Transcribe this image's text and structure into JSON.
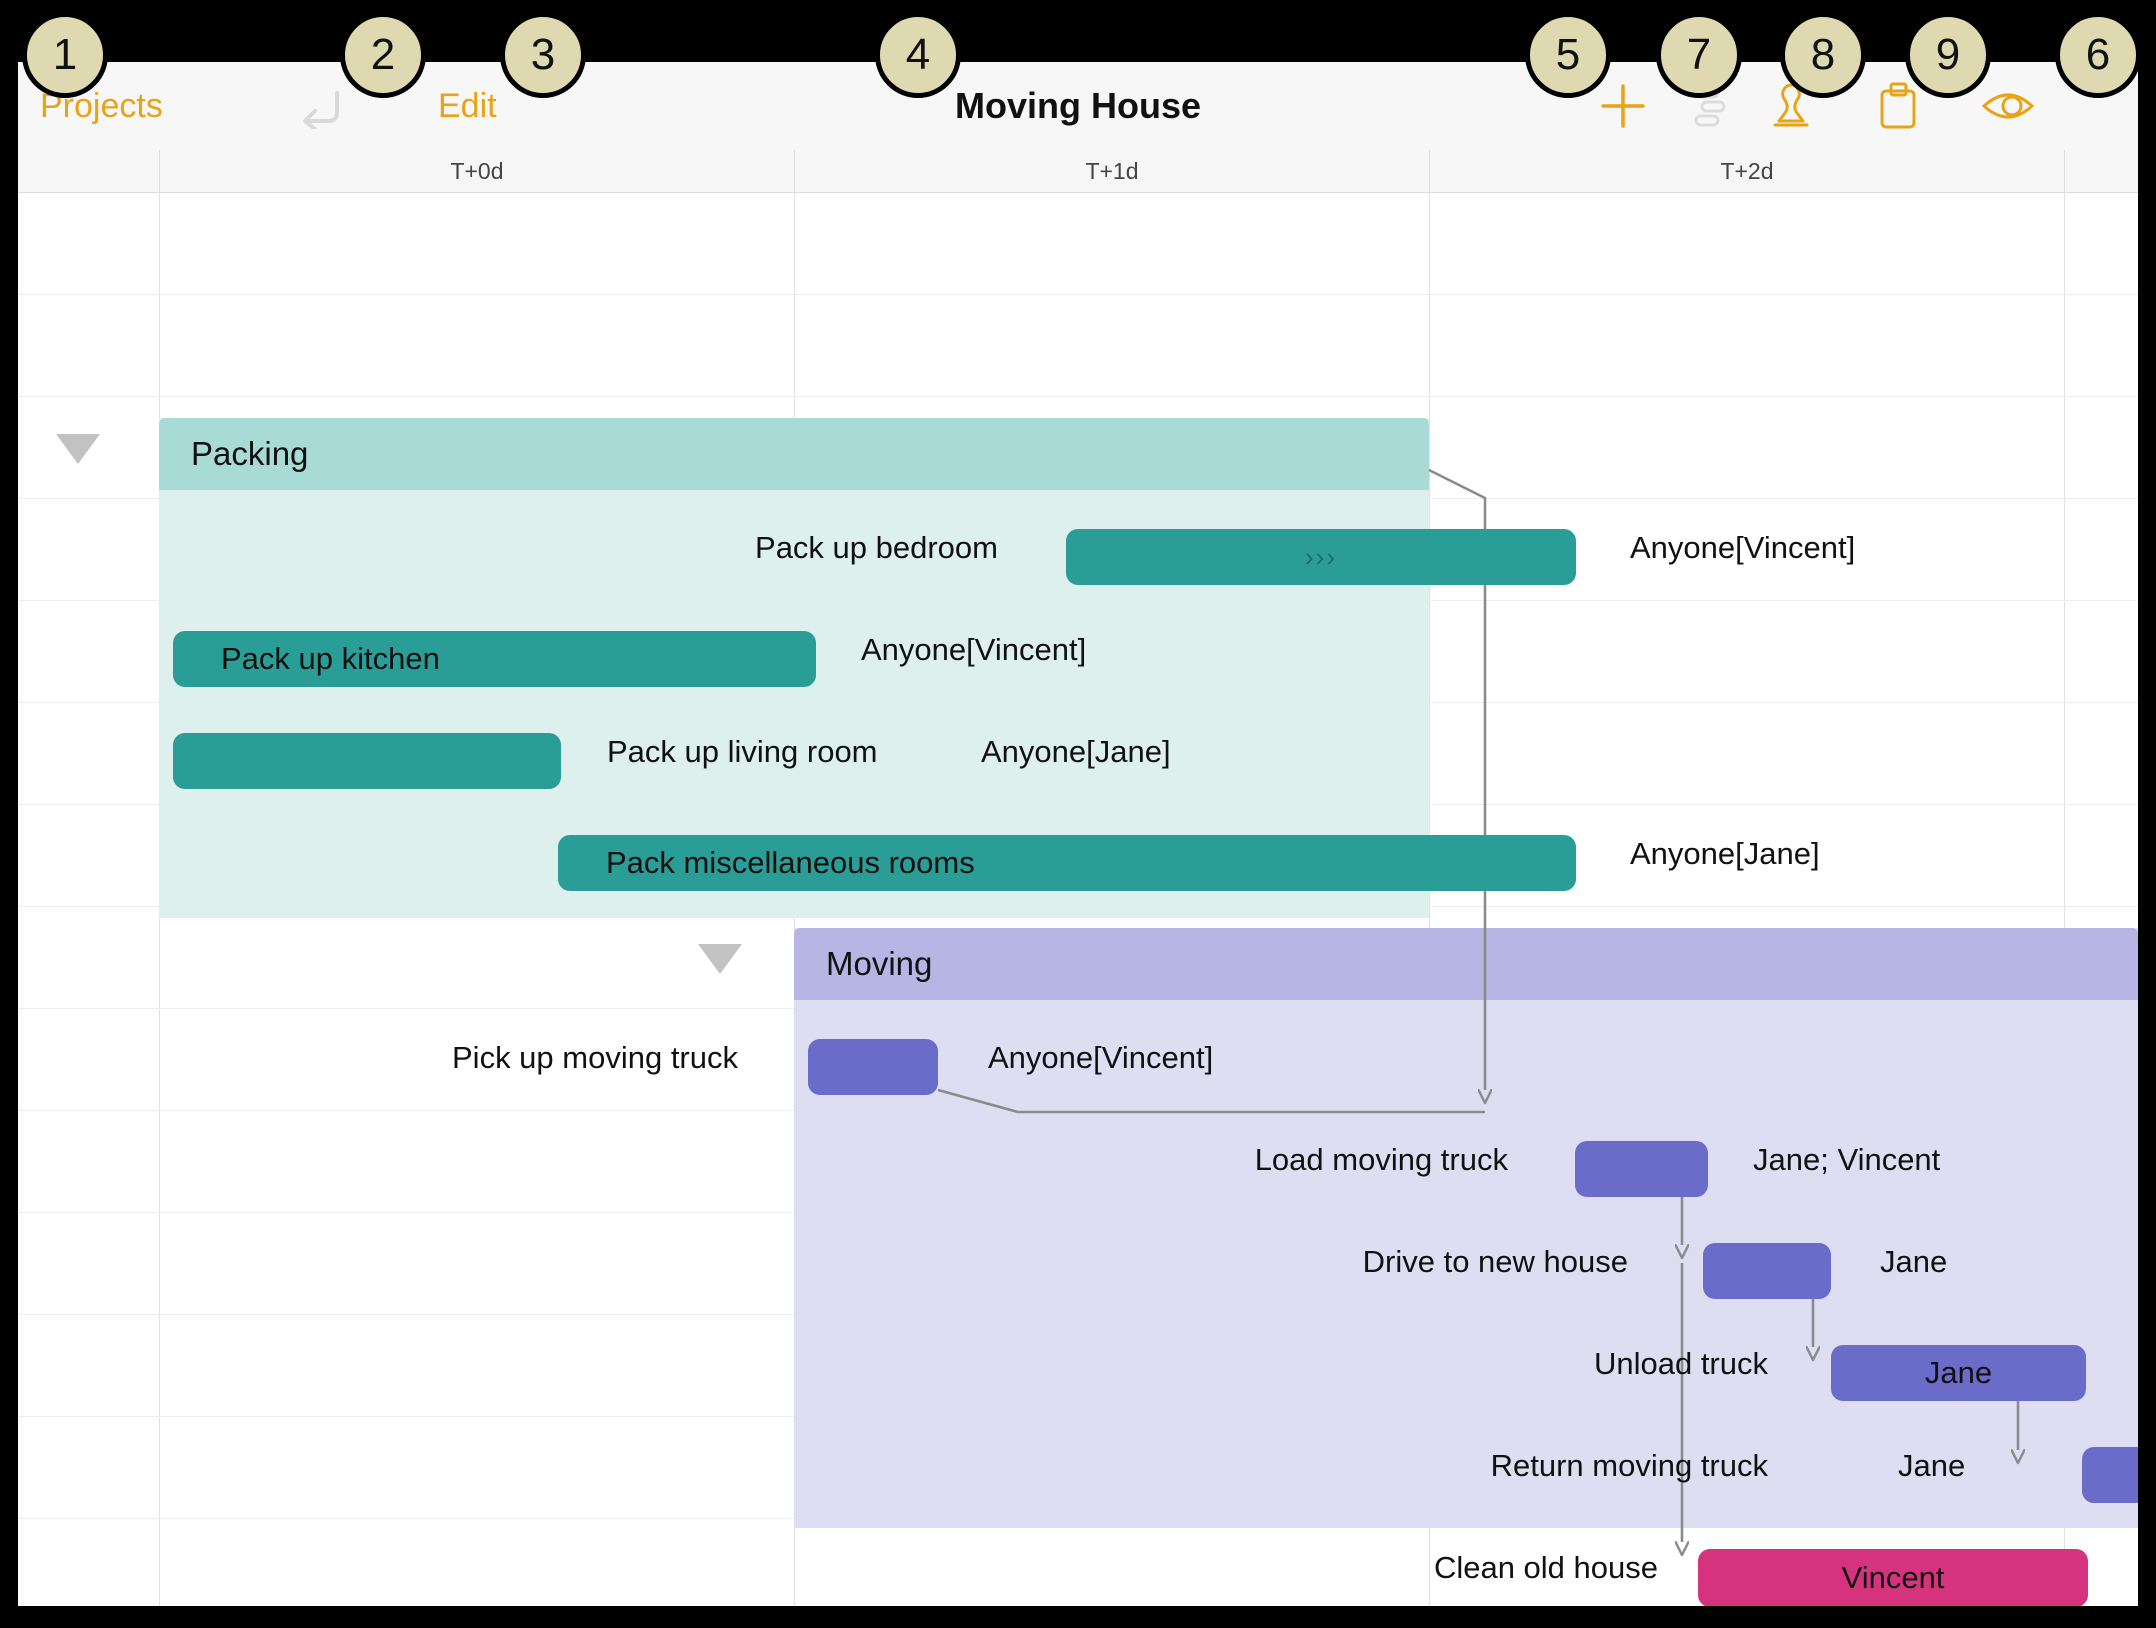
{
  "window": {
    "title": "Moving House"
  },
  "navbar": {
    "back_label": "Projects",
    "undo_icon": "undo-icon",
    "edit_label": "Edit",
    "title": "Moving House",
    "add_icon": "plus-icon",
    "outline_icon": "outline-list-icon",
    "stamp_icon": "stamp-icon",
    "clipboard_icon": "clipboard-icon",
    "eye_icon": "eye-icon"
  },
  "colors": {
    "accent": "#e8a317",
    "packing_group_header": "#a8dbd6",
    "packing_group_body": "#ddf0ee",
    "packing_bar": "#2a9d96",
    "moving_group_header": "#b6b5e4",
    "moving_group_body": "#dedef3",
    "moving_bar": "#6b6bca",
    "clean_bar": "#d6337e",
    "dependency_line": "#8b8b8b",
    "gridline": "#e2e2e2"
  },
  "timeline": {
    "columns": [
      {
        "label": "T+0d"
      },
      {
        "label": "T+1d"
      },
      {
        "label": "T+2d"
      },
      {
        "label": ""
      }
    ]
  },
  "groups": [
    {
      "name": "Packing",
      "label": "Packing",
      "disclosure": "expanded",
      "tasks": [
        {
          "name": "pack-up-bedroom",
          "label": "Pack up bedroom",
          "resource": "Anyone[Vincent]",
          "label_inside": false,
          "resource_inside": false,
          "progress_marker": "›››"
        },
        {
          "name": "pack-up-kitchen",
          "label": "Pack up kitchen",
          "resource": "Anyone[Vincent]",
          "label_inside": true,
          "resource_inside": false,
          "progress_marker": ""
        },
        {
          "name": "pack-up-living-room",
          "label": "Pack up living room",
          "resource": "Anyone[Jane]",
          "label_inside": false,
          "resource_inside": false,
          "progress_marker": ""
        },
        {
          "name": "pack-miscellaneous-rooms",
          "label": "Pack miscellaneous rooms",
          "resource": "Anyone[Jane]",
          "label_inside": true,
          "resource_inside": false,
          "progress_marker": ""
        }
      ]
    },
    {
      "name": "Moving",
      "label": "Moving",
      "disclosure": "expanded",
      "tasks": [
        {
          "name": "pick-up-moving-truck",
          "label": "Pick up moving truck",
          "resource": "Anyone[Vincent]",
          "label_inside": false,
          "resource_inside": false,
          "progress_marker": ""
        },
        {
          "name": "load-moving-truck",
          "label": "Load moving truck",
          "resource": "Jane; Vincent",
          "label_inside": false,
          "resource_inside": false,
          "progress_marker": ""
        },
        {
          "name": "drive-to-new-house",
          "label": "Drive to new house",
          "resource": "Jane",
          "label_inside": false,
          "resource_inside": false,
          "progress_marker": ""
        },
        {
          "name": "unload-truck",
          "label": "Unload truck",
          "resource": "Jane",
          "label_inside": false,
          "resource_inside": true,
          "progress_marker": ""
        },
        {
          "name": "return-moving-truck",
          "label": "Return moving truck",
          "resource": "Jane",
          "label_inside": false,
          "resource_inside": false,
          "progress_marker": ""
        }
      ]
    },
    {
      "name": "Ungrouped",
      "label": "",
      "disclosure": "none",
      "tasks": [
        {
          "name": "clean-old-house",
          "label": "Clean old house",
          "resource": "Vincent",
          "label_inside": false,
          "resource_inside": true,
          "progress_marker": ""
        }
      ]
    }
  ],
  "annotations": [
    {
      "number": "1",
      "target": "projects-back-button"
    },
    {
      "number": "2",
      "target": "undo-button"
    },
    {
      "number": "3",
      "target": "edit-button"
    },
    {
      "number": "4",
      "target": "project-title"
    },
    {
      "number": "5",
      "target": "add-button"
    },
    {
      "number": "7",
      "target": "outline-button"
    },
    {
      "number": "8",
      "target": "stamp-button"
    },
    {
      "number": "9",
      "target": "clipboard-button"
    },
    {
      "number": "6",
      "target": "eye-button"
    }
  ]
}
